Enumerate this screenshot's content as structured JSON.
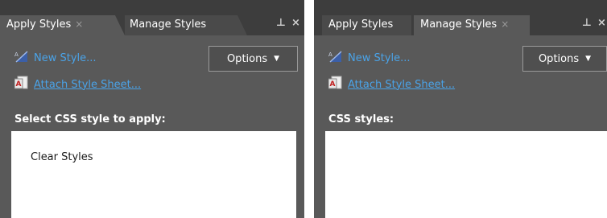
{
  "left_panel": {
    "tabs": [
      {
        "label": "Apply Styles",
        "close": "×"
      },
      {
        "label": "Manage Styles"
      }
    ],
    "pin": "⊥",
    "close": "×",
    "new_style": "New Style...",
    "attach_style_sheet": "Attach Style Sheet...",
    "options_label": "Options",
    "options_arrow": "▼",
    "section_label": "Select CSS style to apply:",
    "list_items": [
      "Clear Styles"
    ]
  },
  "right_panel": {
    "tabs": [
      {
        "label": "Apply Styles"
      },
      {
        "label": "Manage Styles",
        "close": "×"
      }
    ],
    "pin": "⊥",
    "close": "×",
    "new_style": "New Style...",
    "attach_style_sheet": "Attach Style Sheet...",
    "options_label": "Options",
    "options_arrow": "▼",
    "section_label": "CSS styles:"
  },
  "colors": {
    "panel_bg": "#595959",
    "tabstrip_bg": "#3d3d3d",
    "link": "#4aa3e8",
    "list_bg": "#ffffff"
  },
  "icons": [
    "new-style-icon",
    "attach-style-sheet-icon",
    "pin-icon",
    "close-icon",
    "dropdown-arrow-icon"
  ]
}
